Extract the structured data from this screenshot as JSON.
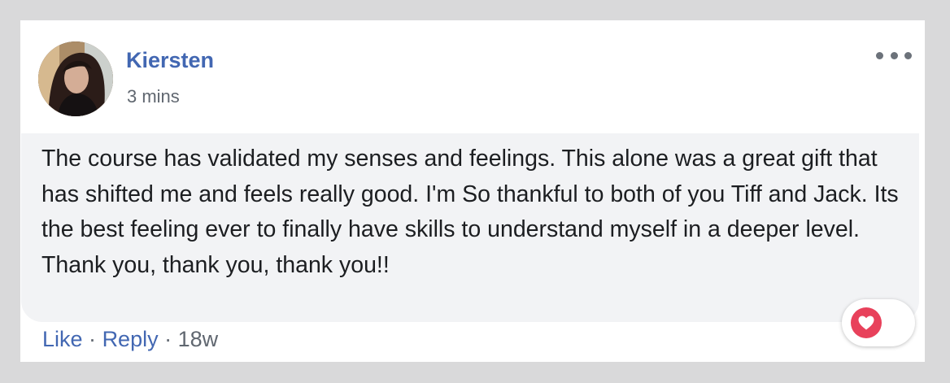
{
  "post": {
    "author": "Kiersten",
    "time": "3 mins",
    "more_icon": "ellipsis-horizontal-icon",
    "avatar_icon": "user-avatar-photo"
  },
  "comment": {
    "text": "The course has validated my senses and feelings. This alone was a great gift that has shifted me and feels really good. I'm So thankful to both of you Tiff and Jack. Its the best feeling ever to finally have skills to understand myself in a deeper level. Thank you, thank you, thank you!!",
    "reaction_icon": "love-heart-icon"
  },
  "actions": {
    "like": "Like",
    "separator": "·",
    "reply": "Reply",
    "age": "18w"
  },
  "colors": {
    "link": "#4267b2",
    "bubble": "#f2f3f5",
    "love": "#e8415b",
    "frame": "#d9d9da"
  }
}
